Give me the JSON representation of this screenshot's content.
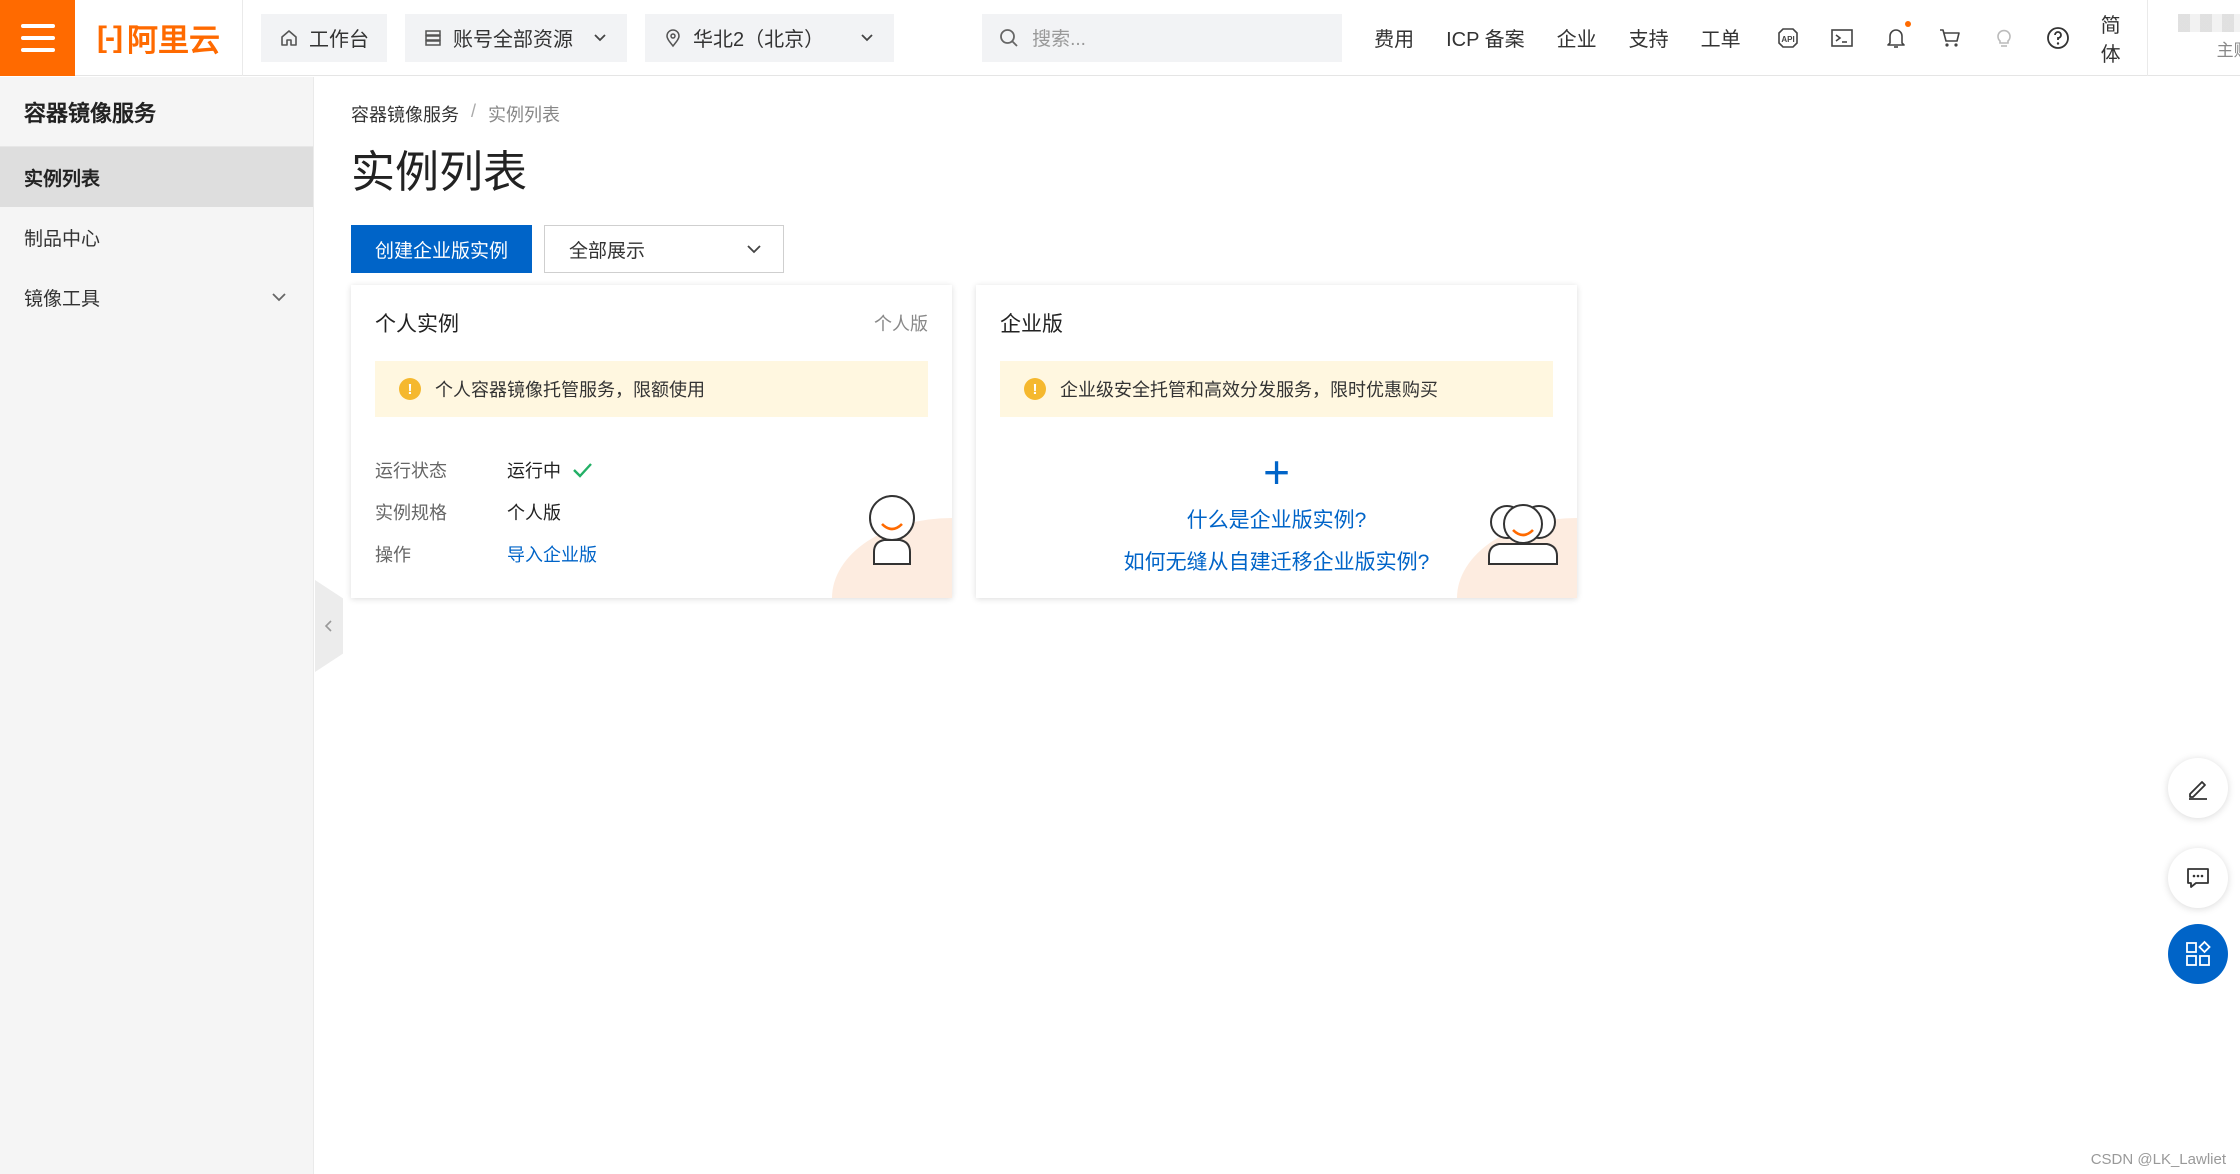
{
  "topbar": {
    "brand": "阿里云",
    "workbench": "工作台",
    "resource_scope": "账号全部资源",
    "region": "华北2（北京）",
    "search_placeholder": "搜索...",
    "links": [
      "费用",
      "ICP 备案",
      "企业",
      "支持",
      "工单"
    ],
    "icons": [
      "api-icon",
      "terminal-icon",
      "bell-icon",
      "cart-icon",
      "bulb-icon",
      "help-icon"
    ],
    "language": "简体",
    "account_role": "主账号"
  },
  "sidebar": {
    "title": "容器镜像服务",
    "items": [
      {
        "label": "实例列表",
        "active": true
      },
      {
        "label": "制品中心",
        "active": false
      },
      {
        "label": "镜像工具",
        "active": false,
        "expandable": true
      }
    ]
  },
  "main": {
    "breadcrumb": [
      "容器镜像服务",
      "实例列表"
    ],
    "breadcrumb_sep": "/",
    "title": "实例列表",
    "create_button": "创建企业版实例",
    "filter_select": "全部展示",
    "personal_card": {
      "title": "个人实例",
      "tag": "个人版",
      "notice": "个人容器镜像托管服务，限额使用",
      "rows": [
        {
          "label": "运行状态",
          "value": "运行中"
        },
        {
          "label": "实例规格",
          "value": "个人版"
        },
        {
          "label": "操作",
          "value": "导入企业版"
        }
      ]
    },
    "enterprise_card": {
      "title": "企业版",
      "notice": "企业级安全托管和高效分发服务，限时优惠购买",
      "plus": "+",
      "link_what": "什么是企业版实例?",
      "link_migrate": "如何无缝从自建迁移企业版实例?"
    }
  },
  "colors": {
    "brand_orange": "#ff6a00",
    "primary_blue": "#0064c8",
    "notice_bg": "#fff7e0",
    "success_green": "#23b066"
  },
  "watermark": "CSDN @LK_Lawliet"
}
